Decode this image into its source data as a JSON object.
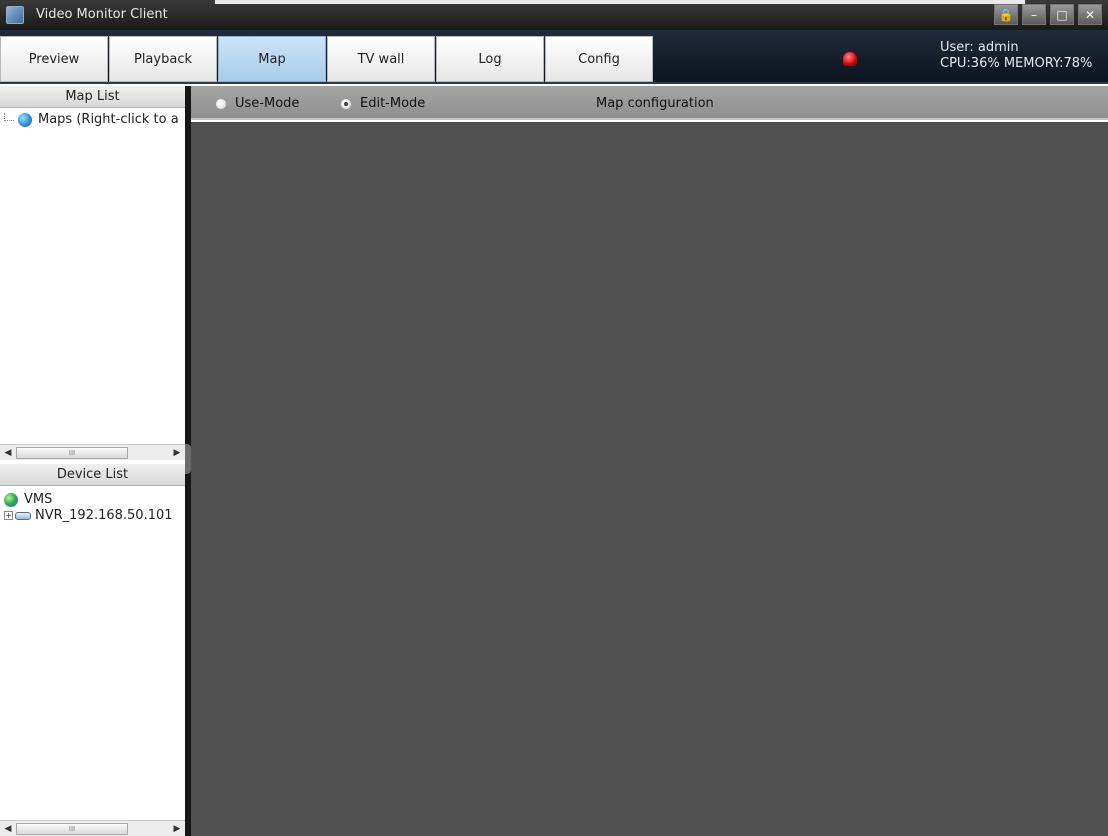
{
  "window": {
    "title": "Video Monitor Client",
    "buttons": [
      "🔒",
      "–",
      "□",
      "✕"
    ]
  },
  "tabs": [
    {
      "label": "Preview"
    },
    {
      "label": "Playback"
    },
    {
      "label": "Map"
    },
    {
      "label": "TV wall"
    },
    {
      "label": "Log"
    },
    {
      "label": "Config"
    }
  ],
  "active_tab": "Map",
  "status": {
    "user": "User: admin",
    "resources": "CPU:36%  MEMORY:78%"
  },
  "map_list": {
    "header": "Map List",
    "root_label": "Maps (Right-click to a"
  },
  "device_list": {
    "header": "Device List",
    "root_label": "VMS",
    "child_label": "NVR_192.168.50.101"
  },
  "scroll_thumb": "III",
  "mode": {
    "use_label": "Use-Mode",
    "edit_label": "Edit-Mode",
    "selected": "Edit-Mode"
  },
  "main_title": "Map configuration"
}
